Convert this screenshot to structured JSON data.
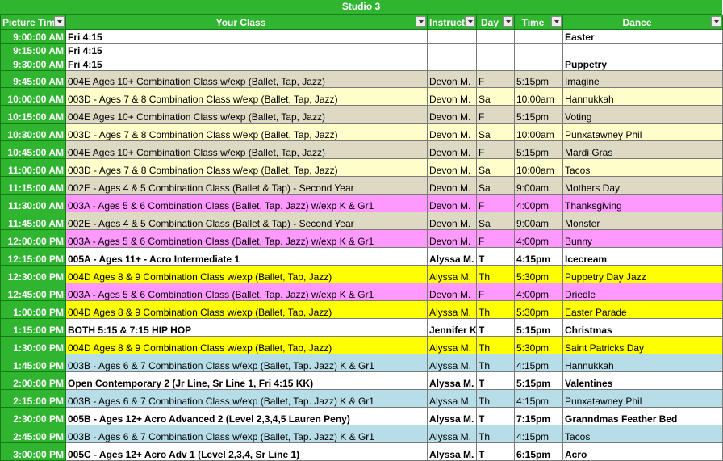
{
  "studio_title": "Studio 3",
  "columns": [
    "Picture Time",
    "Your Class",
    "Instructor",
    "Day",
    "Time",
    "Dance"
  ],
  "colors": {
    "header": "#2fb52f",
    "white": "#ffffff",
    "tan": "#ddd9c3",
    "cream": "#ffffcc",
    "pink": "#ff99ff",
    "yellow": "#ffff00",
    "blue": "#b7dee8"
  },
  "rows": [
    {
      "pt": "9:00:00 AM",
      "cls": "Fri 4:15",
      "ins": "",
      "day": "",
      "tm": "",
      "dance": "Easter",
      "color": "white",
      "bold": true
    },
    {
      "pt": "9:15:00 AM",
      "cls": "Fri 4:15",
      "ins": "",
      "day": "",
      "tm": "",
      "dance": "",
      "color": "white",
      "bold": true
    },
    {
      "pt": "9:30:00 AM",
      "cls": "Fri 4:15",
      "ins": "",
      "day": "",
      "tm": "",
      "dance": "Puppetry",
      "color": "white",
      "bold": true
    },
    {
      "pt": "9:45:00 AM",
      "cls": "004E Ages 10+ Combination Class w/exp (Ballet, Tap, Jazz)",
      "ins": "Devon M.",
      "day": "F",
      "tm": "5:15pm",
      "dance": "Imagine",
      "color": "tan",
      "bold": false
    },
    {
      "pt": "10:00:00 AM",
      "cls": "003D - Ages 7 & 8 Combination Class w/exp (Ballet, Tap, Jazz)",
      "ins": "Devon M.",
      "day": "Sa",
      "tm": "10:00am",
      "dance": "Hannukkah",
      "color": "cream",
      "bold": false
    },
    {
      "pt": "10:15:00 AM",
      "cls": "004E Ages 10+ Combination Class w/exp (Ballet, Tap, Jazz)",
      "ins": "Devon M.",
      "day": "F",
      "tm": "5:15pm",
      "dance": "Voting",
      "color": "tan",
      "bold": false
    },
    {
      "pt": "10:30:00 AM",
      "cls": "003D - Ages 7 & 8 Combination Class w/exp (Ballet, Tap, Jazz)",
      "ins": "Devon M.",
      "day": "Sa",
      "tm": "10:00am",
      "dance": "Punxatawney Phil",
      "color": "cream",
      "bold": false
    },
    {
      "pt": "10:45:00 AM",
      "cls": "004E Ages 10+ Combination Class w/exp (Ballet, Tap, Jazz)",
      "ins": "Devon M.",
      "day": "F",
      "tm": "5:15pm",
      "dance": "Mardi Gras",
      "color": "tan",
      "bold": false
    },
    {
      "pt": "11:00:00 AM",
      "cls": "003D - Ages 7 & 8 Combination Class w/exp (Ballet, Tap, Jazz)",
      "ins": "Devon M.",
      "day": "Sa",
      "tm": "10:00am",
      "dance": "Tacos",
      "color": "cream",
      "bold": false
    },
    {
      "pt": "11:15:00 AM",
      "cls": "002E - Ages 4 & 5 Combination Class (Ballet & Tap) - Second Year",
      "ins": "Devon M.",
      "day": "Sa",
      "tm": "9:00am",
      "dance": "Mothers Day",
      "color": "tan",
      "bold": false
    },
    {
      "pt": "11:30:00 AM",
      "cls": "003A - Ages 5 & 6 Combination Class (Ballet, Tap. Jazz) w/exp K & Gr1",
      "ins": "Devon M.",
      "day": "F",
      "tm": "4:00pm",
      "dance": "Thanksgiving",
      "color": "pink",
      "bold": false
    },
    {
      "pt": "11:45:00 AM",
      "cls": "002E - Ages 4 & 5 Combination Class (Ballet & Tap) - Second Year",
      "ins": "Devon M.",
      "day": "Sa",
      "tm": "9:00am",
      "dance": "Monster",
      "color": "tan",
      "bold": false
    },
    {
      "pt": "12:00:00 PM",
      "cls": "003A - Ages 5 & 6 Combination Class (Ballet, Tap. Jazz) w/exp K & Gr1",
      "ins": "Devon M.",
      "day": "F",
      "tm": "4:00pm",
      "dance": "Bunny",
      "color": "pink",
      "bold": false
    },
    {
      "pt": "12:15:00 PM",
      "cls": "005A - Ages 11+ - Acro Intermediate 1",
      "ins": "Alyssa M.",
      "day": "T",
      "tm": "4:15pm",
      "dance": "Icecream",
      "color": "white",
      "bold": true
    },
    {
      "pt": "12:30:00 PM",
      "cls": "004D Ages 8 & 9 Combination Class w/exp (Ballet, Tap, Jazz)",
      "ins": "Alyssa M.",
      "day": "Th",
      "tm": "5:30pm",
      "dance": "Puppetry Day Jazz",
      "color": "yellow",
      "bold": false
    },
    {
      "pt": "12:45:00 PM",
      "cls": "003A - Ages 5 & 6 Combination Class (Ballet, Tap. Jazz) w/exp K & Gr1",
      "ins": "Devon M.",
      "day": "F",
      "tm": "4:00pm",
      "dance": "Driedle",
      "color": "pink",
      "bold": false
    },
    {
      "pt": "1:00:00 PM",
      "cls": "004D Ages 8 & 9 Combination Class w/exp (Ballet, Tap, Jazz)",
      "ins": "Alyssa M.",
      "day": "Th",
      "tm": "5:30pm",
      "dance": "Easter Parade",
      "color": "yellow",
      "bold": false
    },
    {
      "pt": "1:15:00 PM",
      "cls": "BOTH 5:15 & 7:15 HIP HOP",
      "ins": "Jennifer K.",
      "day": "T",
      "tm": "5:15pm",
      "dance": "Christmas",
      "color": "white",
      "bold": true
    },
    {
      "pt": "1:30:00 PM",
      "cls": "004D Ages 8 & 9 Combination Class w/exp (Ballet, Tap, Jazz)",
      "ins": "Alyssa M.",
      "day": "Th",
      "tm": "5:30pm",
      "dance": "Saint Patricks Day",
      "color": "yellow",
      "bold": false
    },
    {
      "pt": "1:45:00 PM",
      "cls": "003B - Ages 6 & 7 Combination Class w/exp (Ballet, Tap. Jazz) K & Gr1",
      "ins": "Alyssa M.",
      "day": "Th",
      "tm": "4:15pm",
      "dance": "Hannukkah",
      "color": "blue",
      "bold": false
    },
    {
      "pt": "2:00:00 PM",
      "cls": "Open Contemporary 2 (Jr Line, Sr Line 1, Fri 4:15 KK)",
      "ins": "Alyssa M.",
      "day": "T",
      "tm": "5:15pm",
      "dance": "Valentines",
      "color": "white",
      "bold": true
    },
    {
      "pt": "2:15:00 PM",
      "cls": "003B - Ages 6 & 7 Combination Class w/exp (Ballet, Tap. Jazz) K & Gr1",
      "ins": "Alyssa M.",
      "day": "Th",
      "tm": "4:15pm",
      "dance": "Punxatawney Phil",
      "color": "blue",
      "bold": false
    },
    {
      "pt": "2:30:00 PM",
      "cls": "005B - Ages 12+ Acro Advanced 2 (Level 2,3,4,5 Lauren Peny)",
      "ins": "Alyssa M.",
      "day": "T",
      "tm": "7:15pm",
      "dance": "Granndmas Feather Bed",
      "color": "white",
      "bold": true
    },
    {
      "pt": "2:45:00 PM",
      "cls": "003B - Ages 6 & 7 Combination Class w/exp (Ballet, Tap. Jazz) K & Gr1",
      "ins": "Alyssa M.",
      "day": "Th",
      "tm": "4:15pm",
      "dance": "Tacos",
      "color": "blue",
      "bold": false
    },
    {
      "pt": "3:00:00 PM",
      "cls": "005C - Ages 12+ Acro Adv 1 (Level 2,3,4, Sr Line 1)",
      "ins": "Alyssa M.",
      "day": "T",
      "tm": "6:15pm",
      "dance": "Acro",
      "color": "white",
      "bold": true
    }
  ]
}
